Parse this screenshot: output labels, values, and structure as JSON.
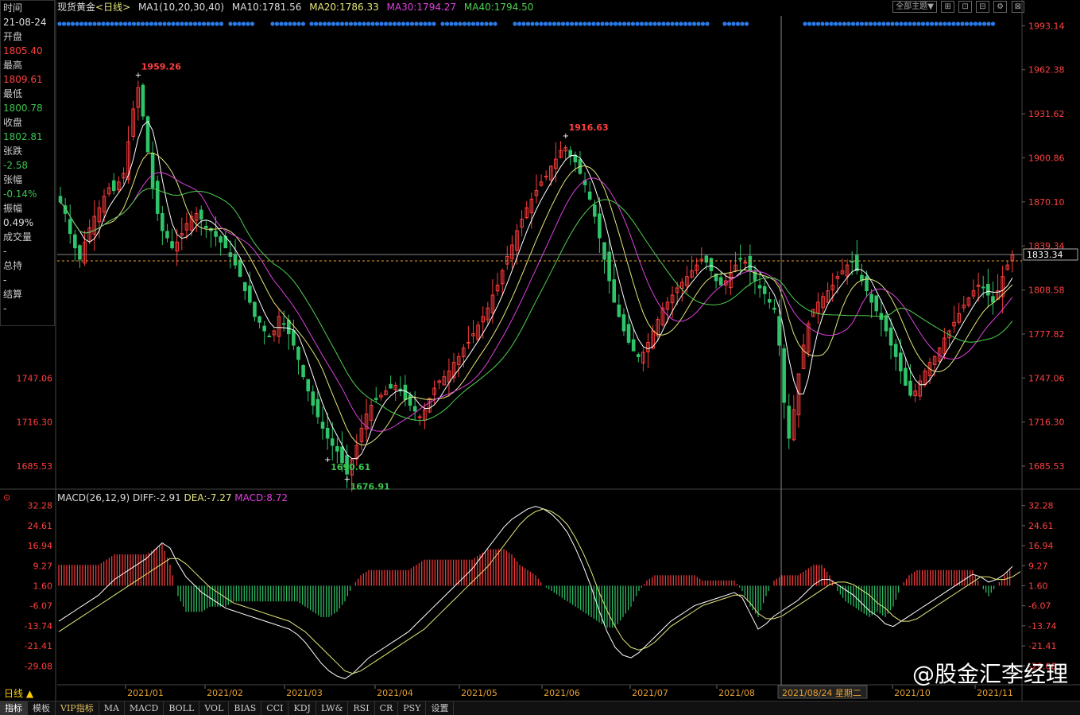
{
  "instrument": "现货黄金",
  "period": "<日线>",
  "ma_header": {
    "label": "MA1(10,20,30,40)",
    "ma10": "MA10:1781.56",
    "ma20": "MA20:1786.33",
    "ma30": "MA30:1794.27",
    "ma40": "MA40:1794.50"
  },
  "toolbar": {
    "theme": "全部主题▼",
    "buttons": [
      "⊞",
      "⊡",
      "⊟",
      "⚙",
      "⊠"
    ]
  },
  "info_panel": {
    "time_label": "时间",
    "time": "21-08-24",
    "open_label": "开盘",
    "open": "1805.40",
    "high_label": "最高",
    "high": "1809.61",
    "low_label": "最低",
    "low": "1800.78",
    "close_label": "收盘",
    "close": "1802.81",
    "change_label": "张跌",
    "change": "-2.58",
    "pct_label": "张幅",
    "pct": "-0.14%",
    "amp_label": "振幅",
    "amp": "0.49%",
    "vol_label": "成交量",
    "vol": "-",
    "oi_label": "总持",
    "oi": "-",
    "settle_label": "结算",
    "settle": "-"
  },
  "macd_header": {
    "label": "MACD(26,12,9)",
    "diff": "DIFF:-2.91",
    "dea": "DEA:-7.27",
    "macd": "MACD:8.72"
  },
  "period_tab": "日线 ▲",
  "bottom_tabs": [
    "指标",
    "模板",
    "VIP指标",
    "MA",
    "MACD",
    "BOLL",
    "VOL",
    "BIAS",
    "CCI",
    "KDJ",
    "LW&",
    "RSI",
    "CR",
    "PSY",
    "设置"
  ],
  "watermark": "@股金汇李经理",
  "colors": {
    "up": "#ff3c3c",
    "down": "#2fc46a",
    "ma10": "#ffffff",
    "ma20": "#e6e67a",
    "ma30": "#e040e0",
    "ma40": "#50d050",
    "axis_red": "#ff4040",
    "axis_green": "#3cc450"
  },
  "chart_data": [
    {
      "type": "candlestick",
      "title": "现货黄金",
      "x_ticks": [
        "2021/01",
        "2021/02",
        "2021/03",
        "2021/04",
        "2021/05",
        "2021/06",
        "2021/07",
        "2021/08",
        "2021/10",
        "2021/11"
      ],
      "y_ticks": [
        "1993.14",
        "1962.38",
        "1931.62",
        "1900.86",
        "1870.10",
        "1839.34",
        "1808.58",
        "1777.82",
        "1747.06",
        "1716.30",
        "1685.53"
      ],
      "ylim": [
        1670,
        2000
      ],
      "current_price": "1833.34",
      "crosshair_date": "2021/08/24 星期二",
      "annotations": [
        {
          "label": "1959.26",
          "kind": "high"
        },
        {
          "label": "1676.91",
          "kind": "low"
        },
        {
          "label": "1916.63",
          "kind": "high"
        },
        {
          "label": "1690.61",
          "kind": "low"
        }
      ],
      "close_path": [
        1870,
        1862,
        1848,
        1838,
        1830,
        1842,
        1852,
        1860,
        1866,
        1874,
        1880,
        1878,
        1884,
        1890,
        1912,
        1935,
        1950,
        1930,
        1905,
        1880,
        1862,
        1850,
        1845,
        1838,
        1842,
        1848,
        1855,
        1860,
        1862,
        1858,
        1852,
        1850,
        1846,
        1842,
        1838,
        1832,
        1826,
        1818,
        1808,
        1800,
        1790,
        1786,
        1780,
        1776,
        1780,
        1790,
        1785,
        1778,
        1770,
        1760,
        1748,
        1738,
        1728,
        1720,
        1712,
        1705,
        1700,
        1696,
        1688,
        1680,
        1690,
        1700,
        1712,
        1722,
        1728,
        1732,
        1735,
        1738,
        1740,
        1742,
        1738,
        1732,
        1728,
        1724,
        1720,
        1725,
        1733,
        1740,
        1745,
        1748,
        1752,
        1758,
        1762,
        1768,
        1772,
        1778,
        1784,
        1790,
        1796,
        1805,
        1812,
        1822,
        1832,
        1840,
        1850,
        1858,
        1866,
        1872,
        1878,
        1884,
        1888,
        1895,
        1900,
        1906,
        1908,
        1902,
        1898,
        1890,
        1882,
        1872,
        1860,
        1845,
        1830,
        1815,
        1800,
        1790,
        1780,
        1772,
        1766,
        1762,
        1765,
        1772,
        1780,
        1788,
        1796,
        1800,
        1805,
        1810,
        1814,
        1818,
        1822,
        1826,
        1830,
        1828,
        1822,
        1815,
        1812,
        1815,
        1820,
        1826,
        1830,
        1828,
        1822,
        1815,
        1810,
        1806,
        1800,
        1795,
        1770,
        1730,
        1705,
        1725,
        1750,
        1770,
        1785,
        1795,
        1800,
        1804,
        1808,
        1812,
        1818,
        1822,
        1826,
        1828,
        1822,
        1815,
        1808,
        1800,
        1794,
        1788,
        1780,
        1770,
        1762,
        1752,
        1742,
        1735,
        1738,
        1745,
        1752,
        1758,
        1762,
        1768,
        1775,
        1780,
        1786,
        1792,
        1798,
        1803,
        1808,
        1812,
        1810,
        1805,
        1800,
        1808,
        1818,
        1826,
        1833
      ],
      "ma_values": {
        "MA10": 1781.56,
        "MA20": 1786.33,
        "MA30": 1794.27,
        "MA40": 1794.5
      }
    },
    {
      "type": "macd",
      "title": "MACD(26,12,9)",
      "y_ticks": [
        "32.28",
        "24.61",
        "16.94",
        "9.27",
        "1.60",
        "-6.07",
        "-13.74",
        "-21.41",
        "-29.08"
      ],
      "ylim": [
        -36,
        34
      ],
      "diff_path": [
        -12,
        -10,
        -8,
        -6,
        -4,
        -2,
        1,
        4,
        6,
        8,
        10,
        12,
        15,
        18,
        16,
        10,
        5,
        2,
        -1,
        -3,
        -5,
        -7,
        -8,
        -9,
        -10,
        -11,
        -12,
        -13,
        -14,
        -15,
        -17,
        -20,
        -24,
        -28,
        -31,
        -33,
        -34,
        -32,
        -29,
        -26,
        -24,
        -22,
        -20,
        -18,
        -16,
        -13,
        -10,
        -7,
        -4,
        -1,
        2,
        5,
        8,
        12,
        16,
        20,
        24,
        27,
        29,
        31,
        32,
        31,
        29,
        26,
        22,
        16,
        9,
        1,
        -8,
        -16,
        -22,
        -25,
        -26,
        -24,
        -21,
        -18,
        -15,
        -12,
        -10,
        -8,
        -6,
        -5,
        -4,
        -3,
        -2,
        -1,
        -3,
        -9,
        -15,
        -13,
        -10,
        -8,
        -6,
        -4,
        -1,
        2,
        4,
        4,
        2,
        0,
        -2,
        -5,
        -8,
        -10,
        -13,
        -14,
        -12,
        -10,
        -8,
        -6,
        -4,
        -2,
        0,
        2,
        4,
        6,
        5,
        3,
        4,
        6,
        9
      ],
      "dea_path": [
        -16,
        -14,
        -12,
        -10,
        -8,
        -6,
        -4,
        -2,
        0,
        2,
        4,
        6,
        8,
        10,
        12,
        12,
        10,
        7,
        4,
        1,
        -1,
        -3,
        -5,
        -6,
        -7,
        -8,
        -9,
        -10,
        -11,
        -12,
        -14,
        -16,
        -19,
        -22,
        -25,
        -28,
        -31,
        -32,
        -31,
        -29,
        -27,
        -25,
        -23,
        -21,
        -19,
        -17,
        -15,
        -12,
        -9,
        -6,
        -3,
        0,
        3,
        6,
        9,
        13,
        17,
        21,
        25,
        28,
        30,
        31,
        30,
        28,
        25,
        20,
        14,
        7,
        -1,
        -8,
        -14,
        -19,
        -22,
        -23,
        -22,
        -20,
        -17,
        -14,
        -12,
        -10,
        -8,
        -6,
        -5,
        -4,
        -3,
        -2,
        -2,
        -5,
        -9,
        -11,
        -11,
        -10,
        -8,
        -6,
        -4,
        -2,
        0,
        2,
        3,
        3,
        2,
        0,
        -2,
        -5,
        -7,
        -10,
        -12,
        -12,
        -11,
        -9,
        -7,
        -5,
        -3,
        -1,
        1,
        3,
        5,
        5,
        4,
        4,
        5,
        7
      ]
    }
  ]
}
